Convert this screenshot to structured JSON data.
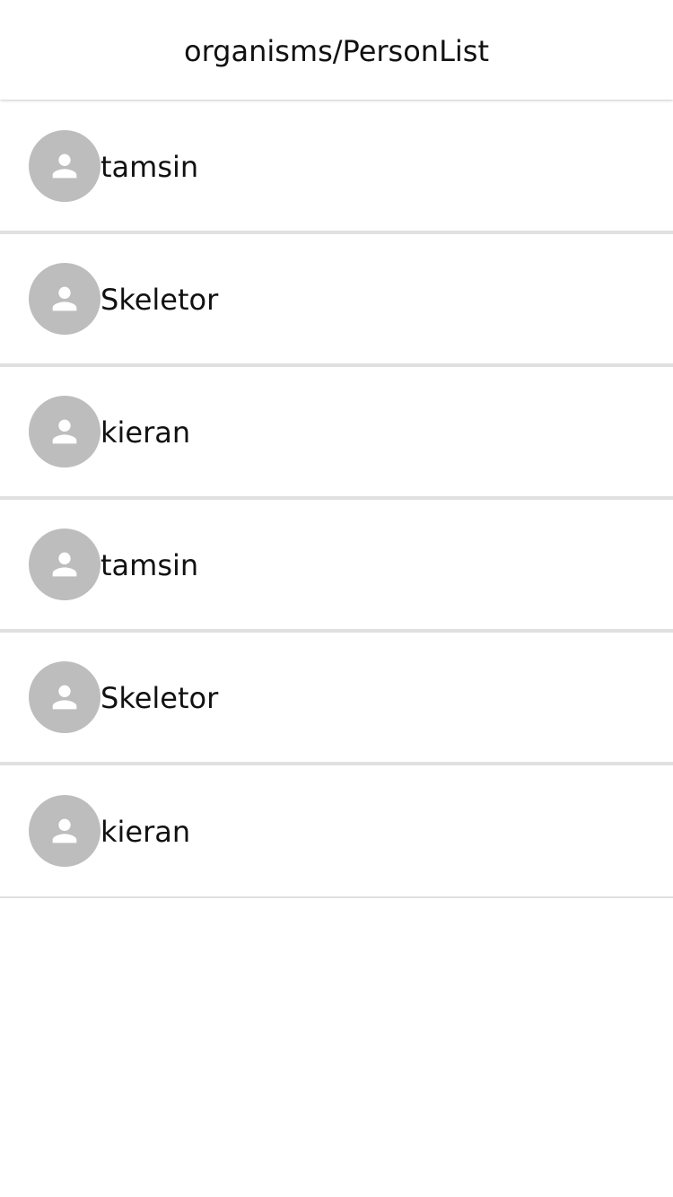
{
  "header": {
    "title": "organisms/PersonList"
  },
  "colors": {
    "avatar_bg": "#bdbdbd",
    "avatar_icon": "#ffffff",
    "divider": "#e0e0e0",
    "text": "#111111"
  },
  "people": [
    {
      "name": "tamsin",
      "icon": "person-icon"
    },
    {
      "name": "Skeletor",
      "icon": "person-icon"
    },
    {
      "name": "kieran",
      "icon": "person-icon"
    },
    {
      "name": "tamsin",
      "icon": "person-icon"
    },
    {
      "name": "Skeletor",
      "icon": "person-icon"
    },
    {
      "name": "kieran",
      "icon": "person-icon"
    }
  ]
}
